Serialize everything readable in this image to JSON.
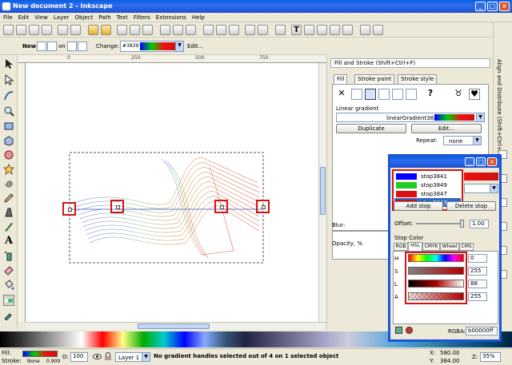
{
  "window": {
    "title": "New document 2 - Inkscape"
  },
  "menu": [
    "File",
    "Edit",
    "View",
    "Layer",
    "Object",
    "Path",
    "Text",
    "Filters",
    "Extensions",
    "Help"
  ],
  "ctrl": {
    "new_label": "New:",
    "on_label": "on",
    "change_label": "Change:",
    "gradient_id": "#3839",
    "edit_label": "Edit..."
  },
  "fill_stroke": {
    "title": "Fill and Stroke (Shift+Ctrl+F)",
    "tabs": [
      "Fill",
      "Stroke paint",
      "Stroke style"
    ],
    "linear_label": "Linear gradient",
    "gradient_name": "linearGradient3839",
    "duplicate": "Duplicate",
    "edit": "Edit...",
    "repeat_label": "Repeat:",
    "repeat_value": "none",
    "blur_label": "Blur:",
    "opacity_label": "Opacity, %"
  },
  "align_label": "Align and Distribute (Shift+Ctrl+A)",
  "gradient_editor": {
    "stops": [
      {
        "name": "stop3841",
        "color": "#0000ff"
      },
      {
        "name": "stop3849",
        "color": "#22cc22"
      },
      {
        "name": "stop3847",
        "color": "#dd1111"
      },
      {
        "name": "stop3843",
        "color": "#cc1111"
      }
    ],
    "add_stop": "Add stop",
    "delete_stop": "Delete stop",
    "offset_label": "Offset:",
    "offset_value": "1.00",
    "stop_color_label": "Stop Color",
    "modes": [
      "RGB",
      "HSL",
      "CMYK",
      "Wheel",
      "CMS"
    ],
    "active_mode": "HSL",
    "channels": [
      {
        "label": "H",
        "value": "0"
      },
      {
        "label": "S",
        "value": "255"
      },
      {
        "label": "L",
        "value": "88"
      },
      {
        "label": "A",
        "value": "255"
      }
    ],
    "rgba_label": "RGBA:",
    "rgba_value": "b00000ff"
  },
  "status": {
    "fill_label": "Fill:",
    "stroke_label": "Stroke:",
    "stroke_value": "None",
    "stroke_width": "0.909",
    "opacity_label": "O:",
    "opacity_value": "100",
    "layer": "Layer 1",
    "message": "No gradient handles selected out of 4 on 1 selected object",
    "x_label": "X:",
    "x_value": "580.00",
    "y_label": "Y:",
    "y_value": "384.00",
    "z_label": "Z:",
    "zoom": "35%"
  },
  "ruler_marks": [
    "250",
    "0",
    "250",
    "500",
    "750"
  ],
  "colors": {
    "selection": "#d31414",
    "accent": "#1a54d8"
  }
}
